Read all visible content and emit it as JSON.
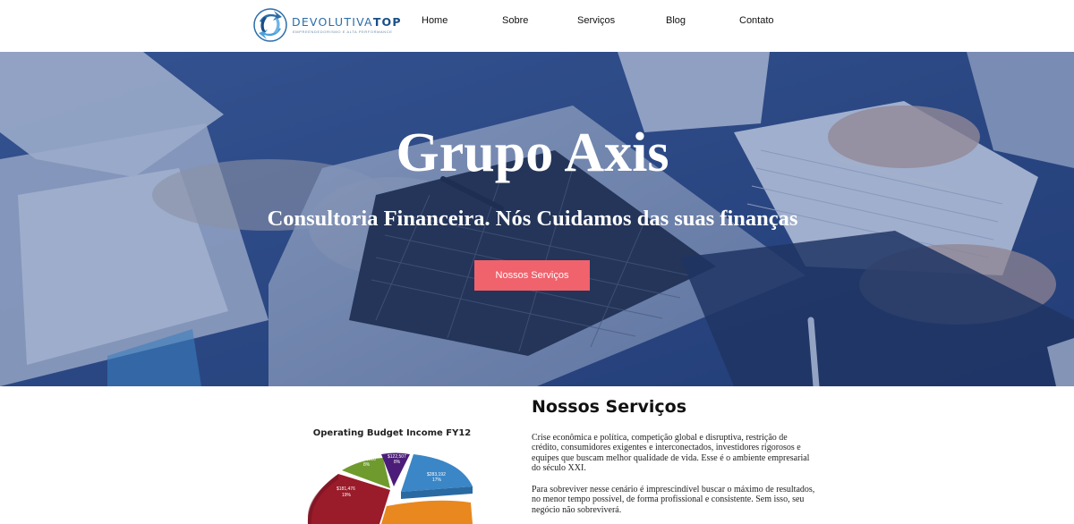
{
  "brand": {
    "name_light": "DEVOLUTIVA",
    "name_bold": "TOP",
    "tagline": "EMPREENDEDORISMO E ALTA PERFORMANCE"
  },
  "nav": {
    "items": [
      {
        "label": "Home"
      },
      {
        "label": "Sobre"
      },
      {
        "label": "Serviços"
      },
      {
        "label": "Blog"
      },
      {
        "label": "Contato"
      }
    ]
  },
  "hero": {
    "title": "Grupo Axis",
    "subtitle": "Consultoria Financeira. Nós Cuidamos das suas finanças",
    "button_label": "Nossos Serviços"
  },
  "services": {
    "heading": "Nossos Serviços",
    "paragraph1": "Crise econômica e política, competição global e disruptiva, restrição de crédito, consumidores exigentes e interconectados, investidores rigorosos e equipes que buscam melhor qualidade de vida. Esse é o ambiente empresarial do século XXI.",
    "paragraph2": "Para sobreviver nesse cenário é imprescindível buscar o máximo de resultados, no menor tempo possível, de forma profissional e consistente. Sem isso, seu negócio não sobreviverá."
  },
  "chart_data": {
    "type": "pie",
    "title": "Operating Budget Income FY12",
    "slices": [
      {
        "label": "$181,476",
        "percent": "19%",
        "color": "#9a1b2a"
      },
      {
        "label": "$128,910",
        "percent": "8%",
        "color": "#6f9a2e"
      },
      {
        "label": "$122,507",
        "percent": "8%",
        "color": "#4b1d78"
      },
      {
        "label": "$283,192",
        "percent": "17%",
        "color": "#3b86c6"
      },
      {
        "label": "",
        "percent": "",
        "color": "#e8881f"
      }
    ]
  },
  "colors": {
    "accent_button": "#f0626c",
    "hero_tint": "#2b467c",
    "brand_blue": "#2a6da8"
  }
}
